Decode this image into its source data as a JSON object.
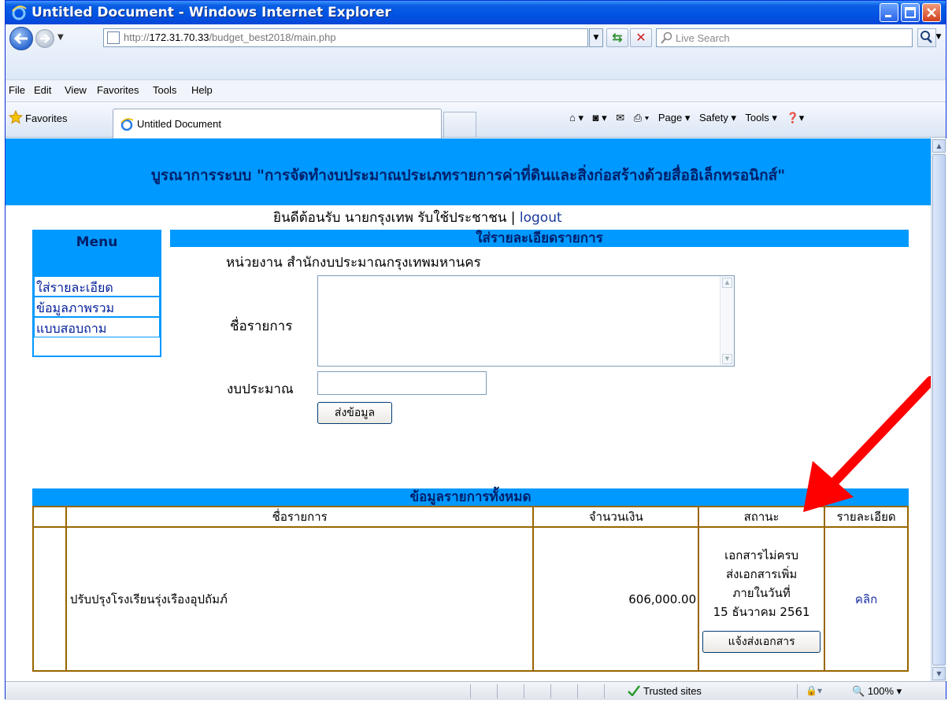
{
  "window": {
    "title": "Untitled Document - Windows Internet Explorer"
  },
  "addressbar": {
    "url_prefix": "http://",
    "url_host": "172.31.70.33",
    "url_path": "/budget_best2018/main.php",
    "search_placeholder": "Live Search"
  },
  "menubar": {
    "items": [
      "File",
      "Edit",
      "View",
      "Favorites",
      "Tools",
      "Help"
    ]
  },
  "favbar": {
    "favorites_label": "Favorites",
    "tab_title": "Untitled Document",
    "commands": [
      "Page ▾",
      "Safety ▾",
      "Tools ▾"
    ]
  },
  "page": {
    "banner": "บูรณาการระบบ \"การจัดทำงบประมาณประเภทรายการค่าที่ดินและสิ่งก่อสร้างด้วยสื่ออิเล็กทรอนิกส์\"",
    "welcome": "ยินดีต้อนรับ นายกรุงเทพ รับใช้ประชาชน | ",
    "logout": "logout",
    "menu": {
      "title": "Menu",
      "items": [
        "ใส่รายละเอียด",
        "ข้อมูลภาพรวม",
        "แบบสอบถาม"
      ]
    },
    "form": {
      "title": "ใส่รายละเอียดรายการ",
      "dept": "หน่วยงาน สำนักงบประมาณกรุงเทพมหานคร",
      "name_label": "ชื่อรายการ",
      "budget_label": "งบประมาณ",
      "submit": "ส่งข้อมูล"
    },
    "list": {
      "title": "ข้อมูลรายการทั้งหมด",
      "columns": [
        "",
        "ชื่อรายการ",
        "จำนวนเงิน",
        "สถานะ",
        "รายละเอียด"
      ],
      "rows": [
        {
          "index": "",
          "name": "ปรับปรุงโรงเรียนรุ่งเรืองอุปถัมภ์",
          "amount": "606,000.00",
          "status_lines": [
            "เอกสารไม่ครบ",
            "ส่งเอกสารเพิ่ม",
            "ภายในวันที่",
            "15 ธันวาคม 2561"
          ],
          "status_button": "แจ้งส่งเอกสาร",
          "detail": "คลิก"
        }
      ]
    }
  },
  "statusbar": {
    "zone": "Trusted sites",
    "zoom": "100%"
  },
  "colors": {
    "header_blue": "#0099ff",
    "table_border": "#996600",
    "arrow_red": "#ff0000"
  }
}
